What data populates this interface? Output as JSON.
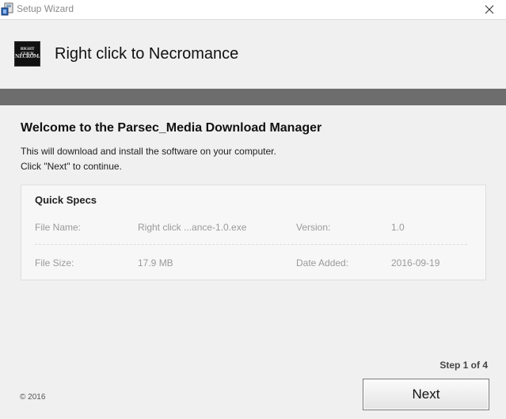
{
  "window": {
    "title": "Setup Wizard",
    "close_icon": "close-icon"
  },
  "header": {
    "logo_line1": "RIGHT CLICK",
    "logo_line2": "NECROMANCE",
    "title": "Right click to Necromance"
  },
  "main": {
    "welcome": "Welcome to the Parsec_Media Download Manager",
    "description_line1": "This will download and install the software on your computer.",
    "description_line2": "Click \"Next\" to continue."
  },
  "specs": {
    "title": "Quick Specs",
    "file_name_label": "File Name:",
    "file_name_value": "Right click ...ance-1.0.exe",
    "version_label": "Version:",
    "version_value": "1.0",
    "file_size_label": "File Size:",
    "file_size_value": "17.9 MB",
    "date_added_label": "Date Added:",
    "date_added_value": "2016-09-19"
  },
  "footer": {
    "step": "Step 1 of 4",
    "copyright": "© 2016",
    "next_label": "Next"
  },
  "colors": {
    "band": "#6d6d6d",
    "background": "#f0f0f0",
    "panel": "#f7f7f7"
  }
}
